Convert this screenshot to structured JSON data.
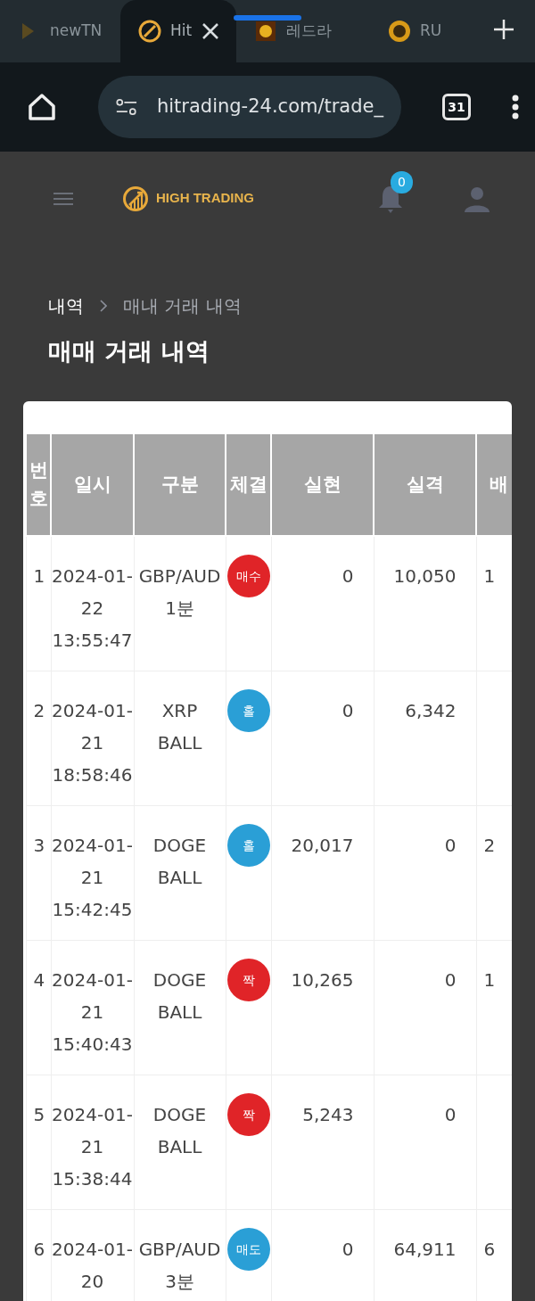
{
  "browser": {
    "tabs": [
      {
        "label": "newTN",
        "selected": false
      },
      {
        "label": "Hit",
        "selected": true
      },
      {
        "label": "레드라",
        "selected": false
      },
      {
        "label": "RU",
        "selected": false
      }
    ],
    "url": "hitrading-24.com/trade_",
    "tab_count": "31"
  },
  "header": {
    "logo": "HIGH TRADING",
    "notification_count": "0"
  },
  "breadcrumb": [
    "내역",
    "매내 거래 내역"
  ],
  "title": "매매 거래 내역",
  "table": {
    "columns": [
      "번호",
      "일시",
      "구분",
      "체결",
      "실현",
      "실격",
      "배"
    ],
    "rows": [
      {
        "no": "1",
        "date": "2024-01-22",
        "time": "13:55:47",
        "symbol": "GBP/AUD",
        "period": "1분",
        "status": "매수",
        "color": "#e02428",
        "realized": "0",
        "loss": "10,050",
        "column_7": "1"
      },
      {
        "no": "2",
        "date": "2024-01-21",
        "time": "18:58:46",
        "symbol": "XRP",
        "period": "BALL",
        "status": "홀",
        "color": "#2a9fd6",
        "realized": "0",
        "loss": "6,342"
      },
      {
        "no": "3",
        "date": "2024-01-21",
        "time": "15:42:45",
        "symbol": "DOGE",
        "period": "BALL",
        "status": "홀",
        "color": "#2a9fd6",
        "realized": "20,017",
        "loss": "0",
        "column_7": "2"
      },
      {
        "no": "4",
        "date": "2024-01-21",
        "time": "15:40:43",
        "symbol": "DOGE",
        "period": "BALL",
        "status": "짝",
        "color": "#e02428",
        "realized": "10,265",
        "loss": "0",
        "column_7": "1"
      },
      {
        "no": "5",
        "date": "2024-01-21",
        "time": "15:38:44",
        "symbol": "DOGE",
        "period": "BALL",
        "status": "짝",
        "color": "#e02428",
        "realized": "5,243",
        "loss": "0"
      },
      {
        "no": "6",
        "date": "2024-01-20",
        "symbol": "GBP/AUD",
        "period": "3분",
        "status": "매도",
        "color": "#2a9fd6",
        "realized": "0",
        "loss": "64,911",
        "column_7": "6"
      }
    ]
  }
}
